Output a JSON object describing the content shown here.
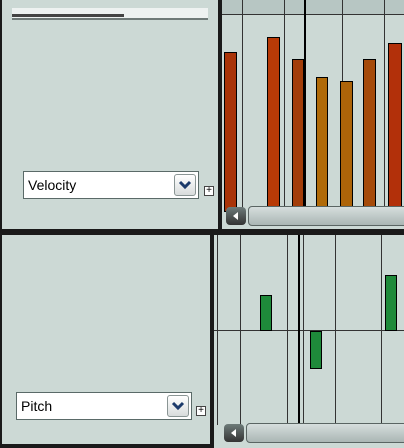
{
  "velocity_lane": {
    "lane_label": "Velocity",
    "plus_glyph": "+",
    "bar_colors": [
      "#a93408",
      "#b83a06",
      "#a33e0a",
      "#b06a08",
      "#ad6409",
      "#a54a09",
      "#b2300a"
    ]
  },
  "pitch_lane": {
    "lane_label": "Pitch",
    "plus_glyph": "+",
    "note_color": "#1e8a3a"
  },
  "icons": {
    "dropdown": "chevron-down-icon",
    "scroll_left": "arrow-left-icon",
    "expand": "plus-box-icon"
  }
}
